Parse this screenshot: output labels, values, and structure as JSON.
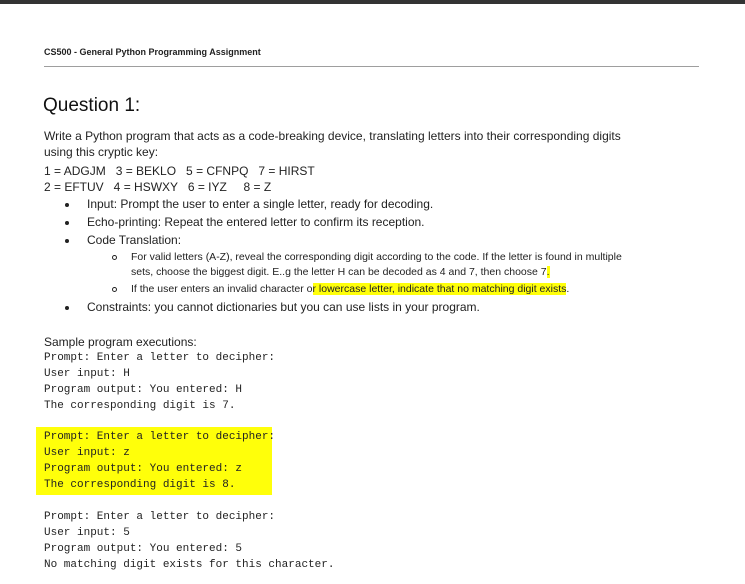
{
  "doc_header": "CS500 - General Python Programming Assignment",
  "question_title": "Question 1:",
  "intro_line1": "Write a Python program that acts as a code-breaking device, translating letters into their corresponding digits",
  "intro_line2": "using this cryptic key:",
  "key_line1": "1 = ADGJM   3 = BEKLO   5 = CFNPQ   7 = HIRST",
  "key_line2": "2 = EFTUV   4 = HSWXY   6 = IYZ     8 = Z",
  "bullets": {
    "input": "Input: Prompt the user to enter a single letter, ready for decoding.",
    "echo": "Echo-printing: Repeat the entered letter to confirm its reception.",
    "code": "Code Translation:",
    "constraints": "Constraints: you cannot dictionaries but you can use lists in your program."
  },
  "sub_bullets": {
    "valid_line1": "For valid letters (A-Z), reveal the corresponding digit according to the code. If the letter is found in multiple",
    "valid_line2_pre": "sets, choose the biggest digit. E..g the letter H can be decoded as 4 and 7, then choose 7",
    "valid_line2_hl": ".",
    "invalid_pre": "If the user enters an invalid character o",
    "invalid_hl": "r lowercase letter, indicate that no matching digit exists",
    "invalid_post": "."
  },
  "sample_heading": "Sample program executions:",
  "examples": [
    {
      "prompt": "Prompt: Enter a letter to decipher:",
      "input": "User input: H",
      "output": "Program output: You entered: H",
      "result": "The corresponding digit is 7."
    },
    {
      "prompt": "Prompt: Enter a letter to decipher:",
      "input": "User input: z",
      "output": "Program output: You entered: z",
      "result": "The corresponding digit is 8."
    },
    {
      "prompt": "Prompt: Enter a letter to decipher:",
      "input": "User input: 5",
      "output": "Program output: You entered: 5",
      "result": "No matching digit exists for this character."
    }
  ],
  "colors": {
    "highlight": "#ffff0a",
    "rule": "#9e9e9e",
    "text": "#222222"
  }
}
